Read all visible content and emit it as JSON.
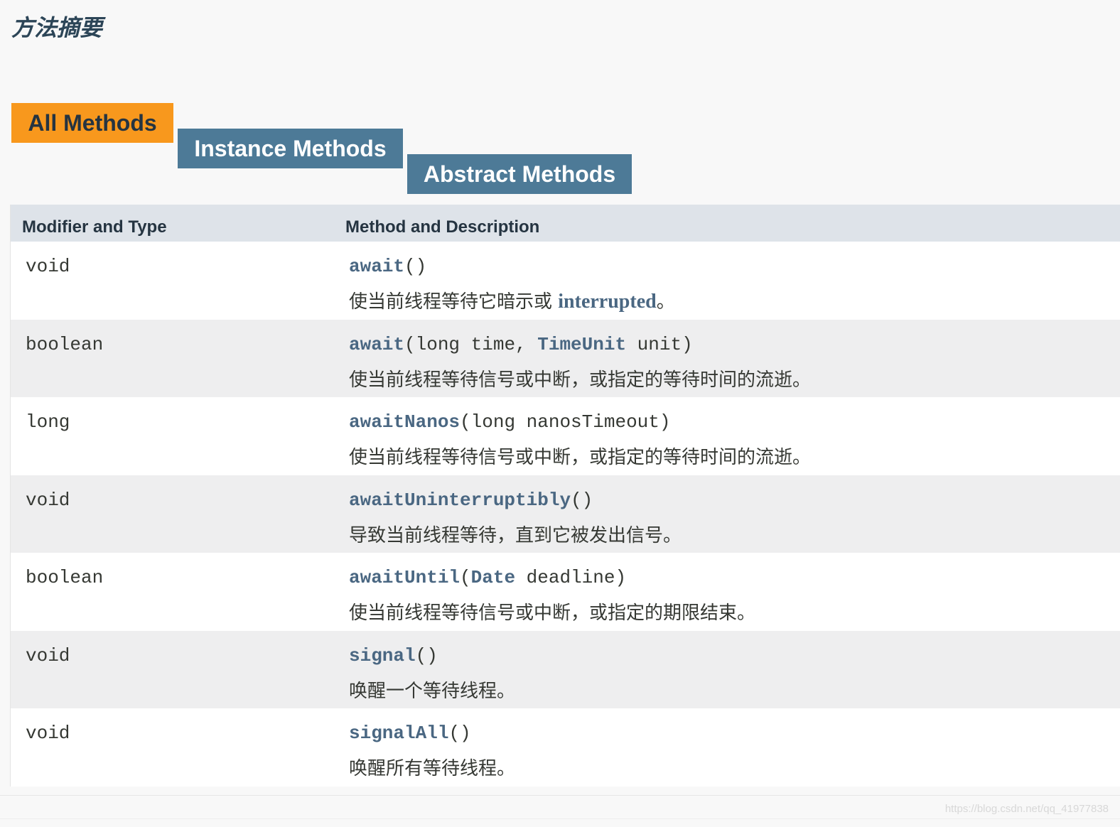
{
  "page_title": "方法摘要",
  "tabs": [
    {
      "label": "All Methods",
      "active": true
    },
    {
      "label": "Instance Methods",
      "active": false
    },
    {
      "label": "Abstract Methods",
      "active": false
    }
  ],
  "table": {
    "headers": [
      "Modifier and Type",
      "Method and Description"
    ],
    "rows": [
      {
        "type": "void",
        "method": "await",
        "params_pre": "()",
        "param_link": "",
        "params_post": "",
        "desc": "使当前线程等待它暗示或 ",
        "desc_link": "interrupted",
        "desc_end": "。"
      },
      {
        "type": "boolean",
        "method": "await",
        "params_pre": "(long time, ",
        "param_link": "TimeUnit",
        "params_post": " unit)",
        "desc": "使当前线程等待信号或中断，或指定的等待时间的流逝。",
        "desc_link": "",
        "desc_end": ""
      },
      {
        "type": "long",
        "method": "awaitNanos",
        "params_pre": "(long nanosTimeout)",
        "param_link": "",
        "params_post": "",
        "desc": "使当前线程等待信号或中断，或指定的等待时间的流逝。",
        "desc_link": "",
        "desc_end": ""
      },
      {
        "type": "void",
        "method": "awaitUninterruptibly",
        "params_pre": "()",
        "param_link": "",
        "params_post": "",
        "desc": "导致当前线程等待，直到它被发出信号。",
        "desc_link": "",
        "desc_end": ""
      },
      {
        "type": "boolean",
        "method": "awaitUntil",
        "params_pre": "(",
        "param_link": "Date",
        "params_post": " deadline)",
        "desc": "使当前线程等待信号或中断，或指定的期限结束。",
        "desc_link": "",
        "desc_end": ""
      },
      {
        "type": "void",
        "method": "signal",
        "params_pre": "()",
        "param_link": "",
        "params_post": "",
        "desc": "唤醒一个等待线程。",
        "desc_link": "",
        "desc_end": ""
      },
      {
        "type": "void",
        "method": "signalAll",
        "params_pre": "()",
        "param_link": "",
        "params_post": "",
        "desc": "唤醒所有等待线程。",
        "desc_link": "",
        "desc_end": ""
      }
    ]
  },
  "watermark": "https://blog.csdn.net/qq_41977838"
}
